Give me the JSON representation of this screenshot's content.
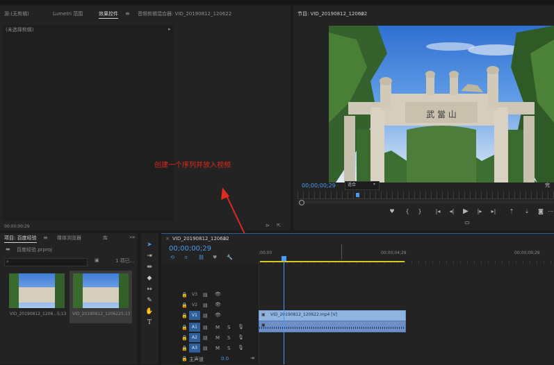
{
  "top_panel": {
    "tabs": [
      "源:(无剪辑)",
      "Lumetri 范围",
      "效果控件",
      "音频剪辑混合器: VID_20190812_120622"
    ],
    "no_clip_label": "(未选择剪辑)",
    "timecode": "00;00;00;29"
  },
  "annotation": {
    "text": "创建一个序列并放入视频",
    "color": "#e0291f"
  },
  "program": {
    "title": "节目: VID_20190812_120622",
    "timecode": "00;00;00;29",
    "fit_label": "适合",
    "right_label": "完",
    "gate_text": "武 當 山"
  },
  "project": {
    "tabs": [
      "项目: 百度经验",
      "媒体浏览器",
      "库"
    ],
    "file_name": "百度经验.prproj",
    "item_count": "1 项已...",
    "items": [
      {
        "name": "VID_20190812_1206...",
        "duration": "5;13"
      },
      {
        "name": "VID_20190812_120622",
        "duration": "5;13"
      }
    ]
  },
  "timeline": {
    "tab_label": "VID_20190812_120622",
    "timecode": "00;00;00;29",
    "ruler_labels": [
      ";00;00",
      "00;00;04;29",
      "00;00;09;29"
    ],
    "video_tracks": [
      "V3",
      "V2",
      "V1"
    ],
    "audio_tracks": [
      "A1",
      "A2",
      "A3"
    ],
    "master_label": "主声道",
    "master_value": "0.0",
    "clip_label": "VID_20190812_120622.mp4 [V]",
    "mute_label": "M",
    "solo_label": "S"
  },
  "colors": {
    "accent": "#4b9cf0",
    "clip_video": "#8fb4e0",
    "clip_audio": "#6f8fc8",
    "track_target": "#2e5f9a",
    "work_area": "#d9c923"
  }
}
